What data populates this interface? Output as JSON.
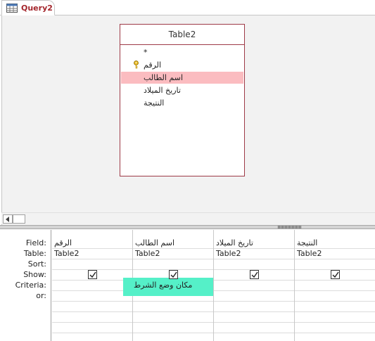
{
  "tab": {
    "label": "Query2"
  },
  "table": {
    "title": "Table2",
    "fields": [
      "*",
      "الرقم",
      "اسم الطالب",
      "تاريخ الميلاد",
      "النتيجة"
    ],
    "selected_field": "اسم الطالب",
    "key_field": "الرقم"
  },
  "grid": {
    "row_labels": [
      "Field:",
      "Table:",
      "Sort:",
      "Show:",
      "Criteria:",
      "or:"
    ],
    "columns": [
      {
        "field": "الرقم",
        "table": "Table2",
        "sort": "",
        "show": true,
        "criteria": ""
      },
      {
        "field": "اسم الطالب",
        "table": "Table2",
        "sort": "",
        "show": true,
        "criteria": "مكان وضع الشرط"
      },
      {
        "field": "تاريخ الميلاد",
        "table": "Table2",
        "sort": "",
        "show": true,
        "criteria": ""
      },
      {
        "field": "النتيجة",
        "table": "Table2",
        "sort": "",
        "show": true,
        "criteria": ""
      }
    ]
  },
  "colors": {
    "tab_text": "#a4262c",
    "table_border": "#9e3a47",
    "selected_field_bg": "#fbbcc0",
    "criteria_highlight": "#55f0c8"
  }
}
